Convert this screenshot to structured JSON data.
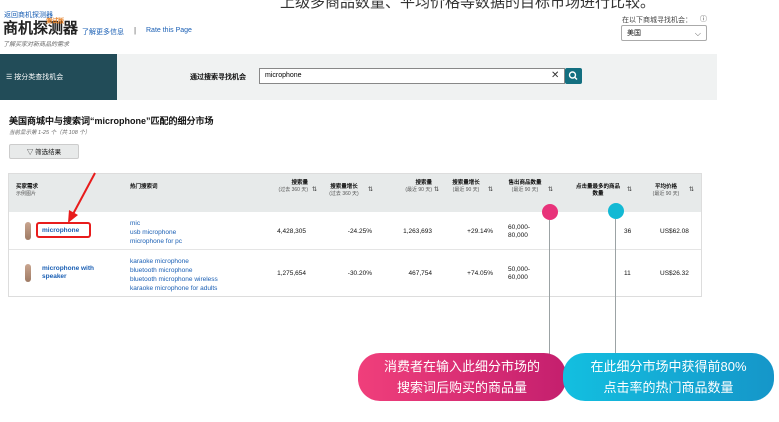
{
  "top_caption": "上级多商品数量、平均价格等数据的目标市场进行比较。",
  "header": {
    "back_link": "返回商机探测器",
    "logo": "商机探测器",
    "logo_badge": "测试版",
    "subtitle": "了解买家对新商品的需求",
    "learn_more": "了解更多信息",
    "separator": "|",
    "rate": "Rate this Page",
    "marketplace_label": "在以下商城寻找机会：",
    "marketplace_value": "美国"
  },
  "nav": {
    "category_button": "按分类查找机会",
    "search_label": "通过搜索寻找机会",
    "search_value": "microphone"
  },
  "main": {
    "title": "美国商城中与搜索词“microphone”匹配的细分市场",
    "results_count": "当前显示第 1-25 个（共 108 个）",
    "filter_button": "筛选结果"
  },
  "table": {
    "headers": {
      "demand": "买家需求",
      "demand_sub": "示例图片",
      "top_terms": "热门搜索词",
      "volume": "搜索量",
      "volume_sub": "(过去 360 天)",
      "growth": "搜索量增长",
      "growth_sub": "(过去 360 天)",
      "volume90": "搜索量",
      "volume90_sub": "(最近 90 天)",
      "growth90": "搜索量增长",
      "growth90_sub": "(最近 90 天)",
      "units": "售出商品数量",
      "units_sub": "(最近 90 天)",
      "top_clicked": "点击量最多的商品数量",
      "avg_price": "平均价格",
      "avg_price_sub": "(最近 90 天)"
    },
    "rows": [
      {
        "demand": "microphone",
        "terms": [
          "mic",
          "usb microphone",
          "microphone for pc"
        ],
        "volume": "4,428,305",
        "growth": "-24.25%",
        "volume90": "1,263,693",
        "growth90": "+29.14%",
        "units_line1": "60,000-",
        "units_line2": "80,000",
        "top_clicked": "36",
        "avg_price": "US$62.08"
      },
      {
        "demand_line1": "microphone with",
        "demand_line2": "speaker",
        "terms": [
          "karaoke microphone",
          "bluetooth microphone",
          "bluetooth microphone wireless",
          "karaoke microphone for adults"
        ],
        "volume": "1,275,654",
        "growth": "-30.20%",
        "volume90": "467,754",
        "growth90": "+74.05%",
        "units_line1": "50,000-",
        "units_line2": "60,000",
        "top_clicked": "11",
        "avg_price": "US$26.32"
      }
    ]
  },
  "annotations": {
    "pink_line1": "消费者在输入此细分市场的",
    "pink_line2": "搜索词后购买的商品量",
    "cyan_line1": "在此细分市场中获得前80%",
    "cyan_line2": "点击率的热门商品数量",
    "pink_color": "#e8337a",
    "cyan_color": "#13b9d4"
  }
}
